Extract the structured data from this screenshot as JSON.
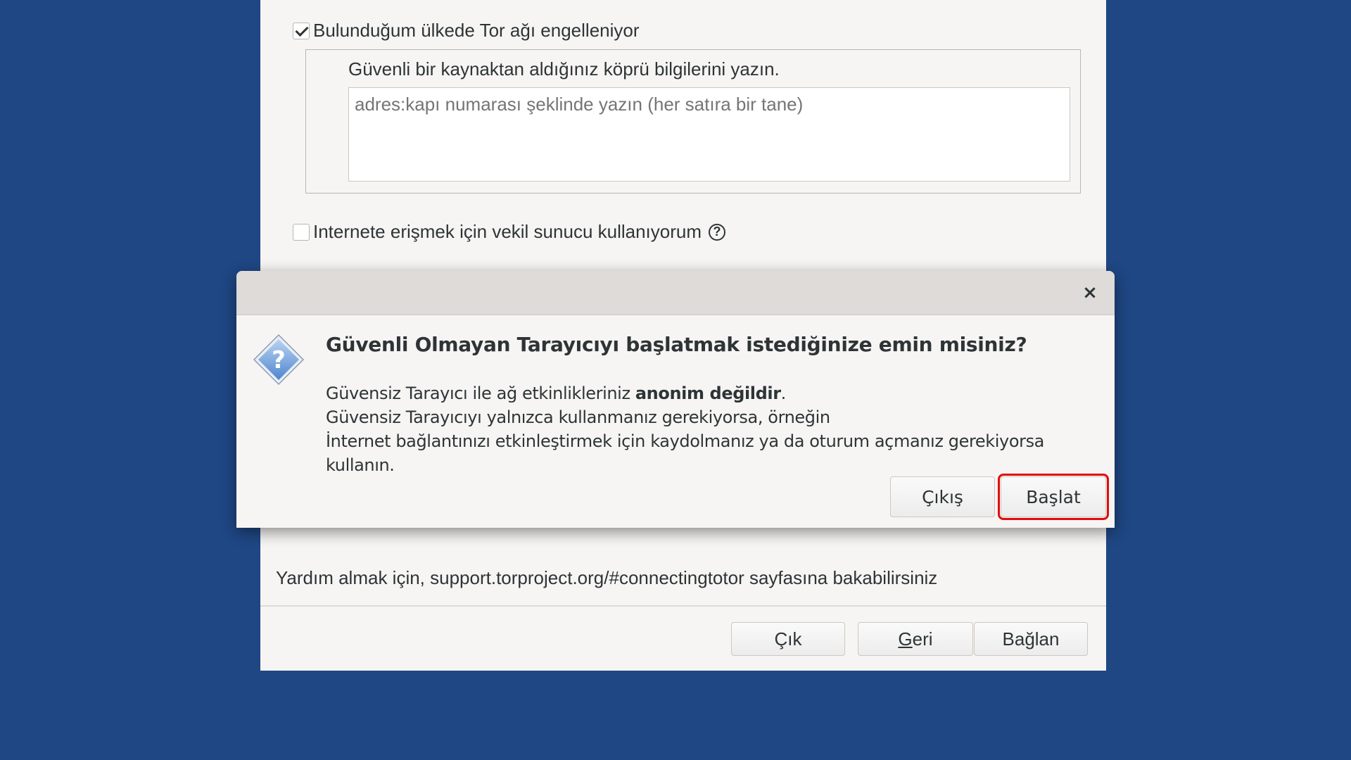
{
  "background_window": {
    "bridge_checkbox_label": "Bulunduğum ülkede Tor ağı engelleniyor",
    "bridge_checkbox_checked": true,
    "bridge_instruction": "Güvenli bir kaynaktan aldığınız köprü bilgilerini yazın.",
    "bridge_input_placeholder": "adres:kapı numarası şeklinde yazın (her satıra bir tane)",
    "bridge_input_value": "",
    "proxy_checkbox_label": "Internete erişmek için vekil sunucu kullanıyorum",
    "proxy_checkbox_checked": false,
    "proxy_help_glyph": "?",
    "help_text": "Yardım almak için, support.torproject.org/#connectingtotor sayfasına bakabilirsiniz",
    "buttons": {
      "quit": "Çık",
      "back": "Geri",
      "connect": "Bağlan"
    }
  },
  "dialog": {
    "close_glyph": "×",
    "title": "Güvenli Olmayan Tarayıcıyı başlatmak istediğinize emin misiniz?",
    "body_line1_prefix": "Güvensiz Tarayıcı ile ağ etkinlikleriniz ",
    "body_line1_bold": "anonim değildir",
    "body_line1_suffix": ".",
    "body_line2": "Güvensiz Tarayıcıyı yalnızca kullanmanız gerekiyorsa, örneğin",
    "body_line3": "İnternet bağlantınızı etkinleştirmek için kaydolmanız ya da oturum açmanız gerekiyorsa kullanın.",
    "icon": "question-icon",
    "buttons": {
      "exit": "Çıkış",
      "start": "Başlat"
    }
  },
  "colors": {
    "desktop_bg": "#1f4784",
    "window_bg": "#f6f5f4",
    "highlight": "#e10b0b"
  }
}
